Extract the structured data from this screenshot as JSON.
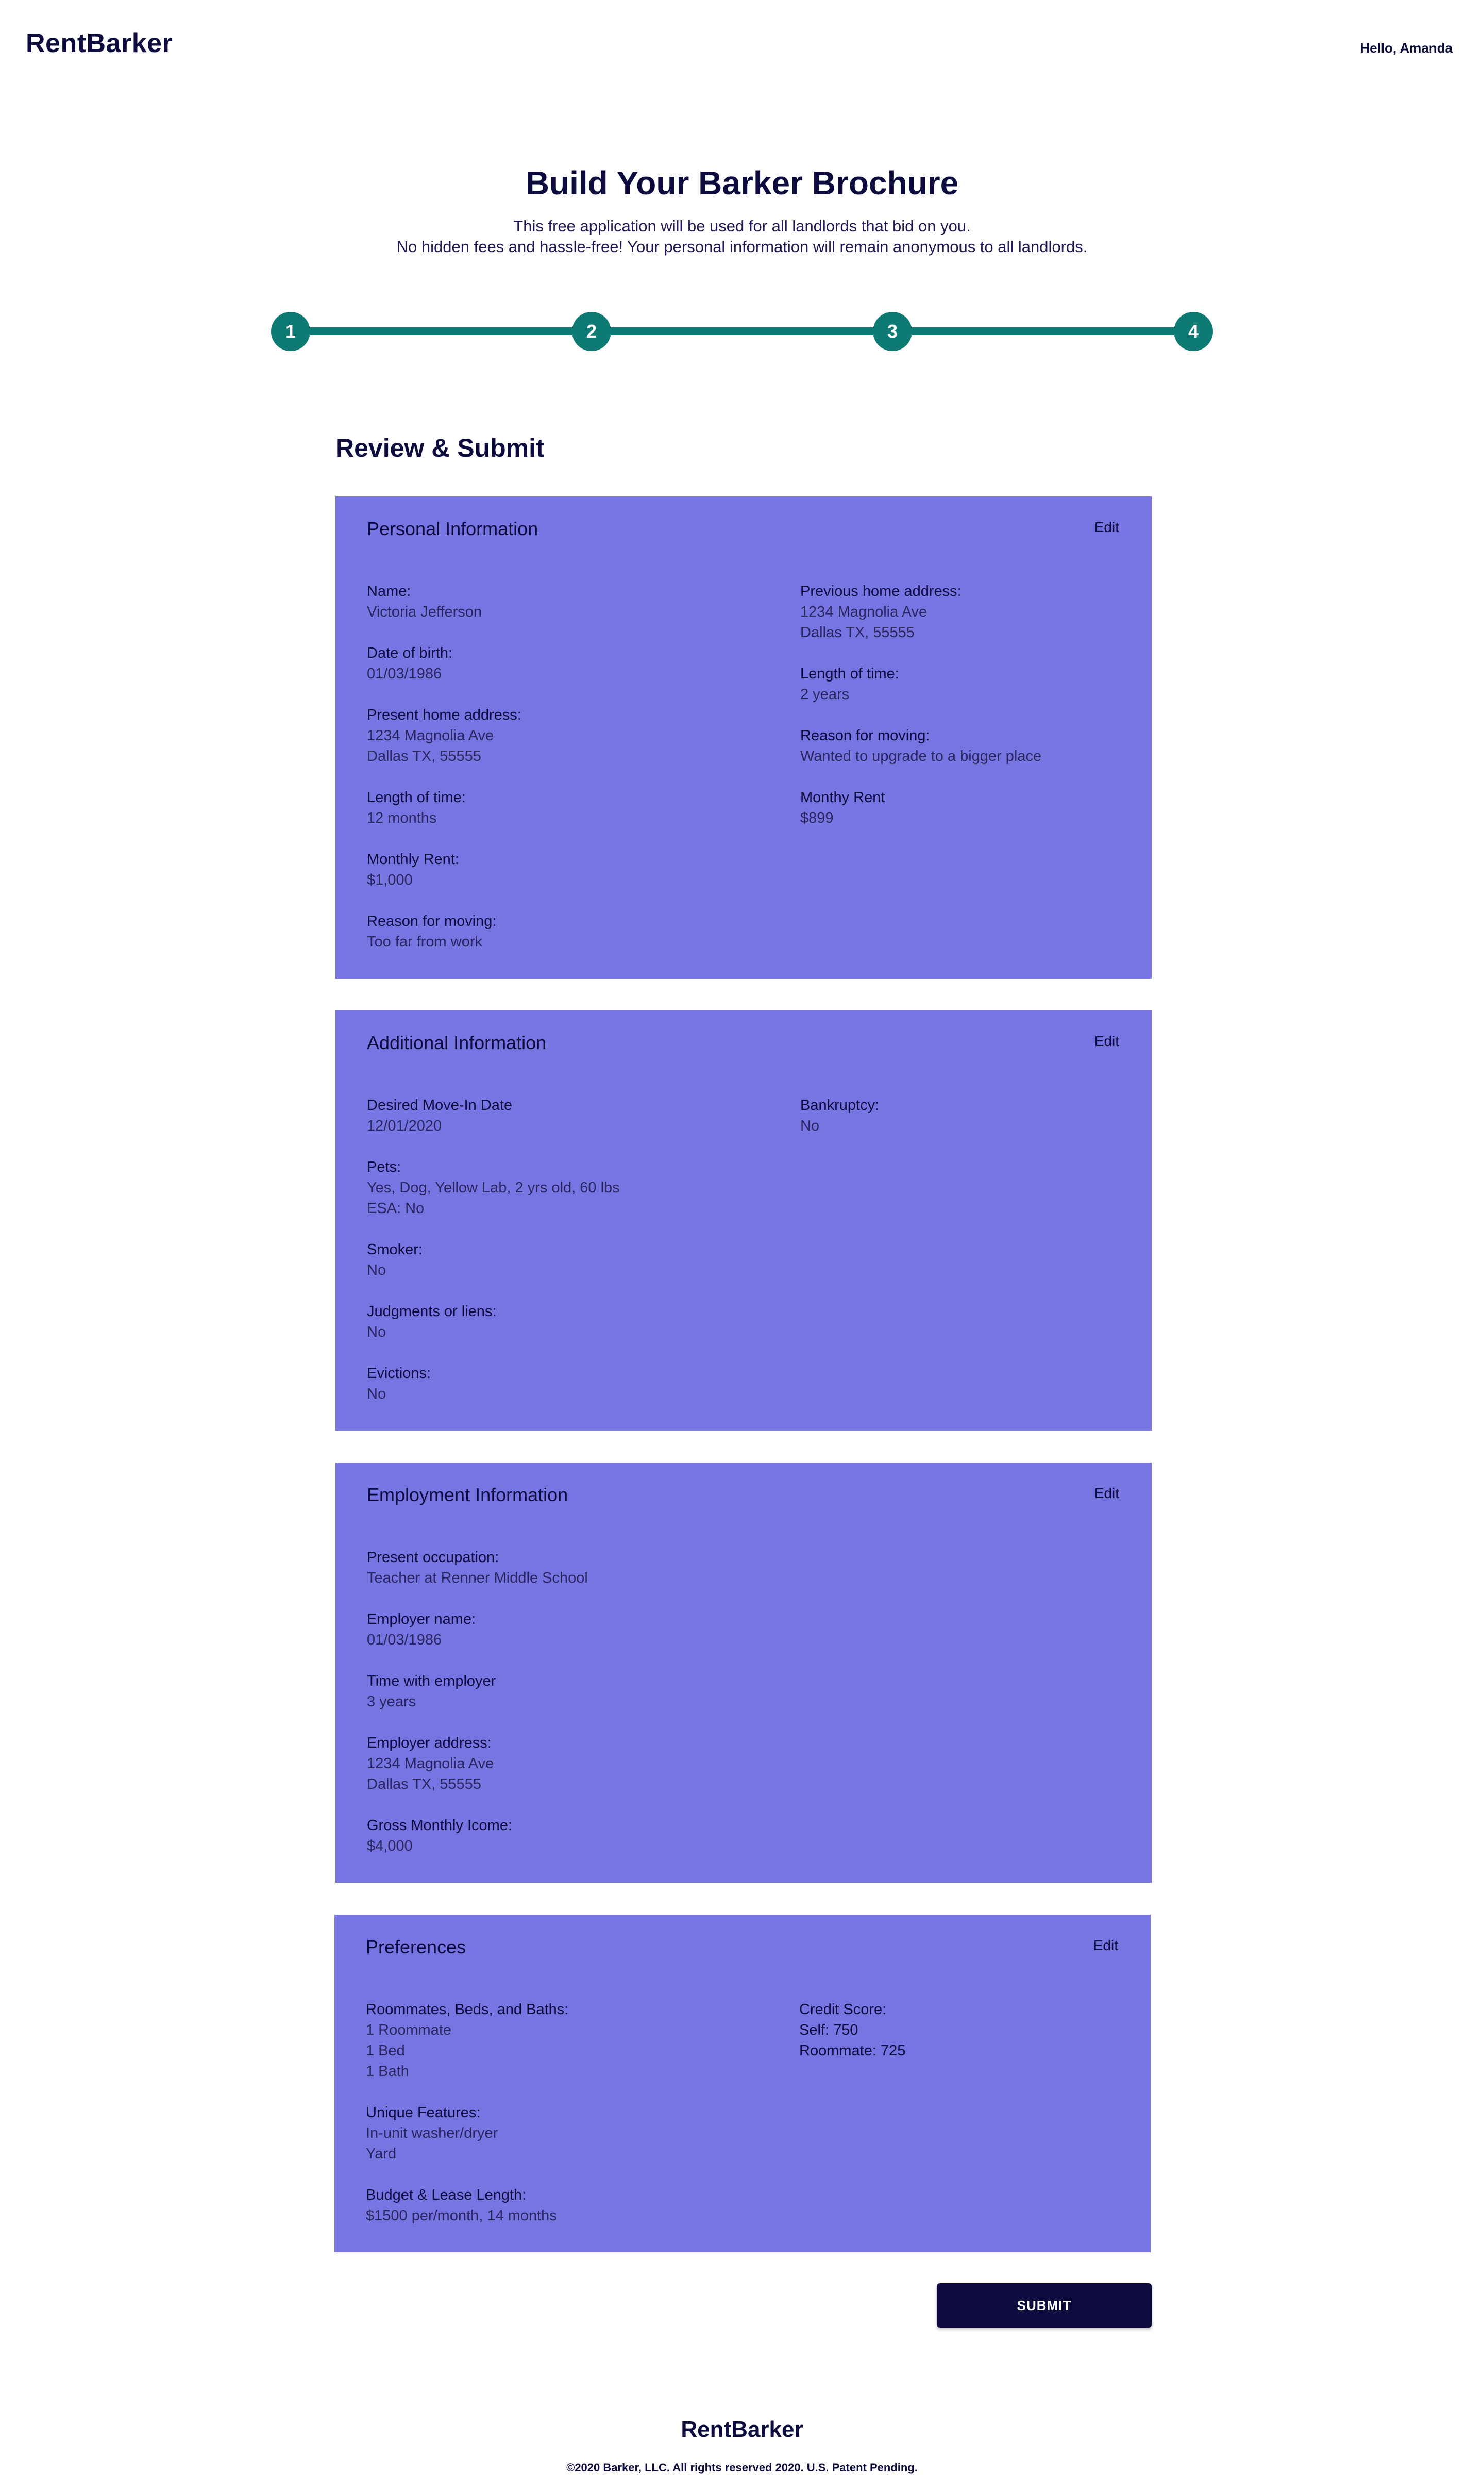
{
  "header": {
    "logo": "RentBarker",
    "greeting": "Hello, Amanda"
  },
  "hero": {
    "title": "Build Your Barker Brochure",
    "subtitle_line1": "This free application will be used for all landlords that bid on you.",
    "subtitle_line2": "No hidden fees and hassle-free! Your personal information will remain anonymous to all landlords."
  },
  "stepper": {
    "steps": [
      "1",
      "2",
      "3",
      "4"
    ],
    "accent_color": "#0d7a73"
  },
  "review": {
    "heading": "Review & Submit"
  },
  "cards": {
    "edit_label": "Edit",
    "personal": {
      "title": "Personal Information",
      "left": [
        {
          "label": "Name:",
          "lines": [
            "Victoria Jefferson"
          ]
        },
        {
          "label": "Date of birth:",
          "lines": [
            "01/03/1986"
          ]
        },
        {
          "label": "Present home address:",
          "lines": [
            "1234 Magnolia Ave",
            "Dallas TX, 55555"
          ]
        },
        {
          "label": "Length of time:",
          "lines": [
            "12 months"
          ]
        },
        {
          "label": "Monthly Rent:",
          "lines": [
            "$1,000"
          ]
        },
        {
          "label": "Reason for moving:",
          "lines": [
            "Too far from work"
          ]
        }
      ],
      "right": [
        {
          "label": "Previous home address:",
          "lines": [
            "1234 Magnolia Ave",
            "Dallas TX, 55555"
          ]
        },
        {
          "label": "Length of time:",
          "lines": [
            "2 years"
          ]
        },
        {
          "label": "Reason for moving:",
          "lines": [
            "Wanted to upgrade to a bigger place"
          ]
        },
        {
          "label": "Monthy Rent",
          "lines": [
            "$899"
          ]
        }
      ]
    },
    "additional": {
      "title": "Additional Information",
      "left": [
        {
          "label": "Desired Move-In Date",
          "lines": [
            "12/01/2020"
          ]
        },
        {
          "label": "Pets:",
          "lines": [
            "Yes, Dog, Yellow Lab, 2 yrs old, 60 lbs",
            "ESA: No"
          ]
        },
        {
          "label": "Smoker:",
          "lines": [
            "No"
          ]
        },
        {
          "label": "Judgments or liens:",
          "lines": [
            "No"
          ]
        },
        {
          "label": "Evictions:",
          "lines": [
            "No"
          ]
        }
      ],
      "right": [
        {
          "label": "Bankruptcy:",
          "lines": [
            "No"
          ]
        }
      ]
    },
    "employment": {
      "title": "Employment Information",
      "left": [
        {
          "label": "Present occupation:",
          "lines": [
            "Teacher at Renner Middle School"
          ]
        },
        {
          "label": "Employer name:",
          "lines": [
            "01/03/1986"
          ]
        },
        {
          "label": "Time with employer",
          "lines": [
            "3 years"
          ]
        },
        {
          "label": "Employer address:",
          "lines": [
            "1234 Magnolia Ave",
            "Dallas TX, 55555"
          ]
        },
        {
          "label": "Gross Monthly Icome:",
          "lines": [
            "$4,000"
          ]
        }
      ],
      "right": []
    },
    "preferences": {
      "title": "Preferences",
      "left": [
        {
          "label": "Roommates, Beds, and Baths:",
          "lines": [
            "1 Roommate",
            "1 Bed",
            "1 Bath"
          ]
        },
        {
          "label": "Unique Features:",
          "lines": [
            "In-unit washer/dryer",
            "Yard"
          ]
        },
        {
          "label": "Budget & Lease Length:",
          "lines": [
            "$1500 per/month, 14 months"
          ]
        }
      ],
      "right": [
        {
          "label": "Credit Score:",
          "lines": [
            "Self: 750",
            "Roommate: 725"
          ],
          "strong": true
        }
      ]
    }
  },
  "actions": {
    "submit_label": "SUBMIT"
  },
  "footer": {
    "logo": "RentBarker",
    "copyright": "©2020 Barker, LLC. All rights reserved 2020. U.S. Patent Pending."
  },
  "colors": {
    "navy": "#0d0a3d",
    "card_bg": "#7775e2",
    "teal": "#0d7a73"
  }
}
